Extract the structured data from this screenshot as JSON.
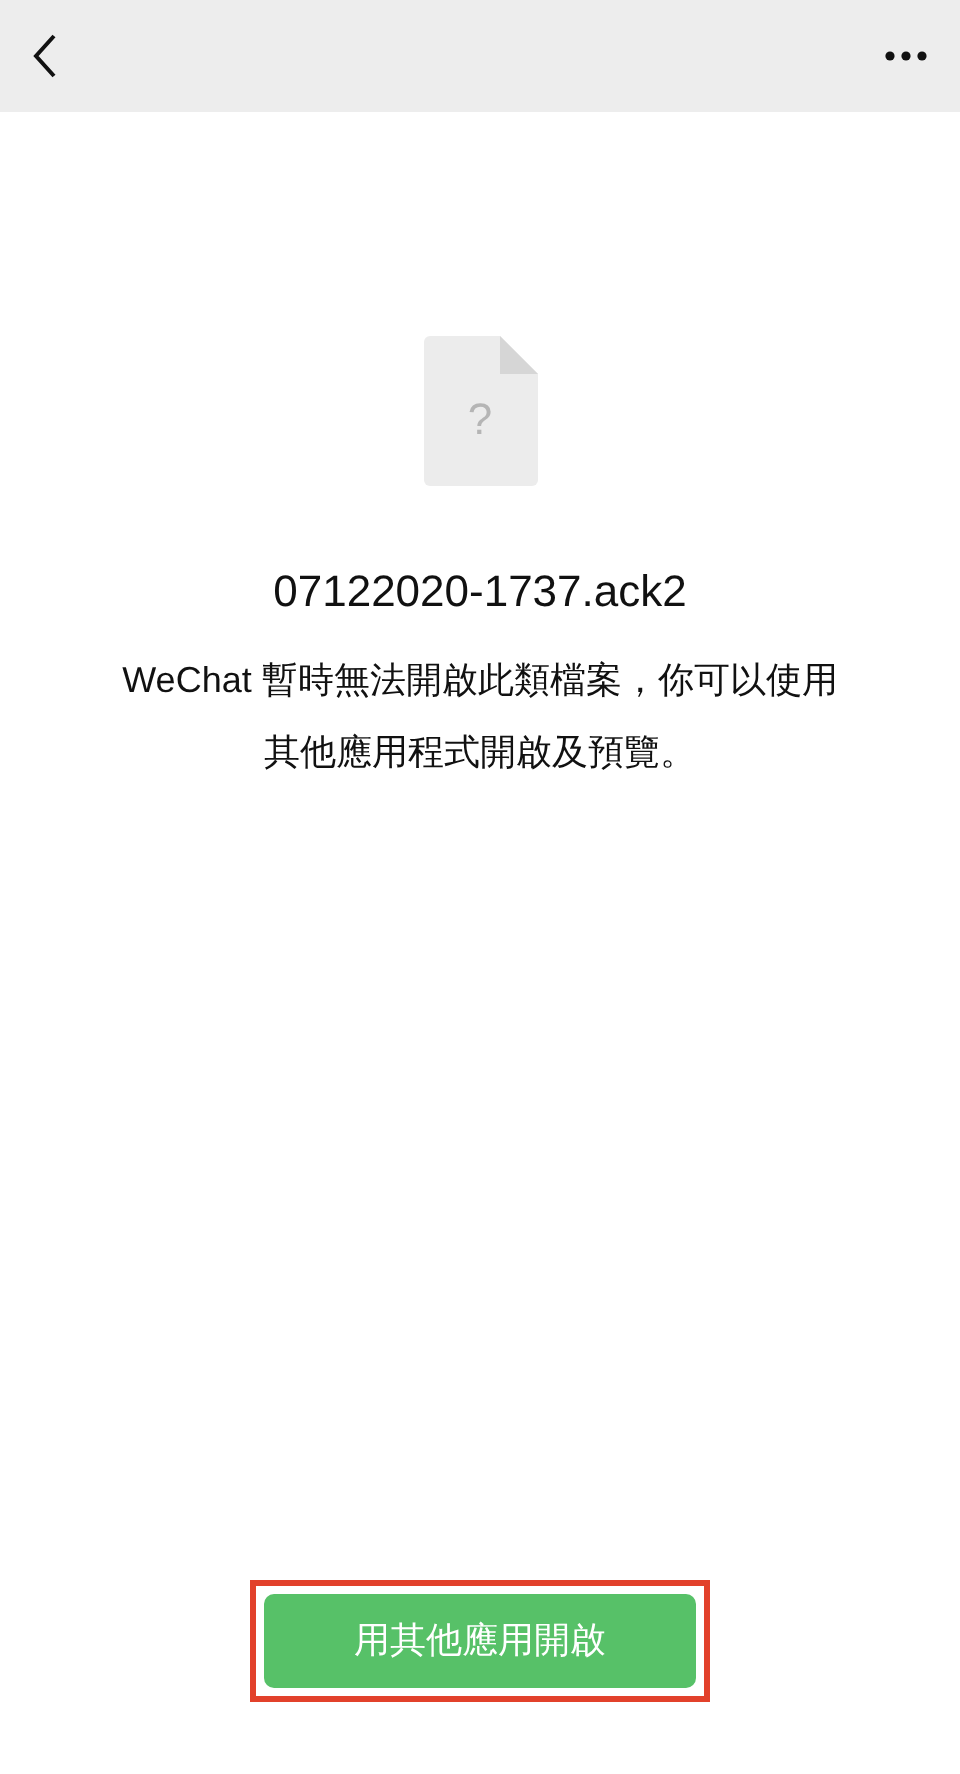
{
  "file": {
    "name": "07122020-1737.ack2",
    "icon_mark": "?"
  },
  "message": "WeChat 暫時無法開啟此類檔案，你可以使用其他應用程式開啟及預覽。",
  "button": {
    "label": "用其他應用開啟",
    "highlighted": true
  }
}
